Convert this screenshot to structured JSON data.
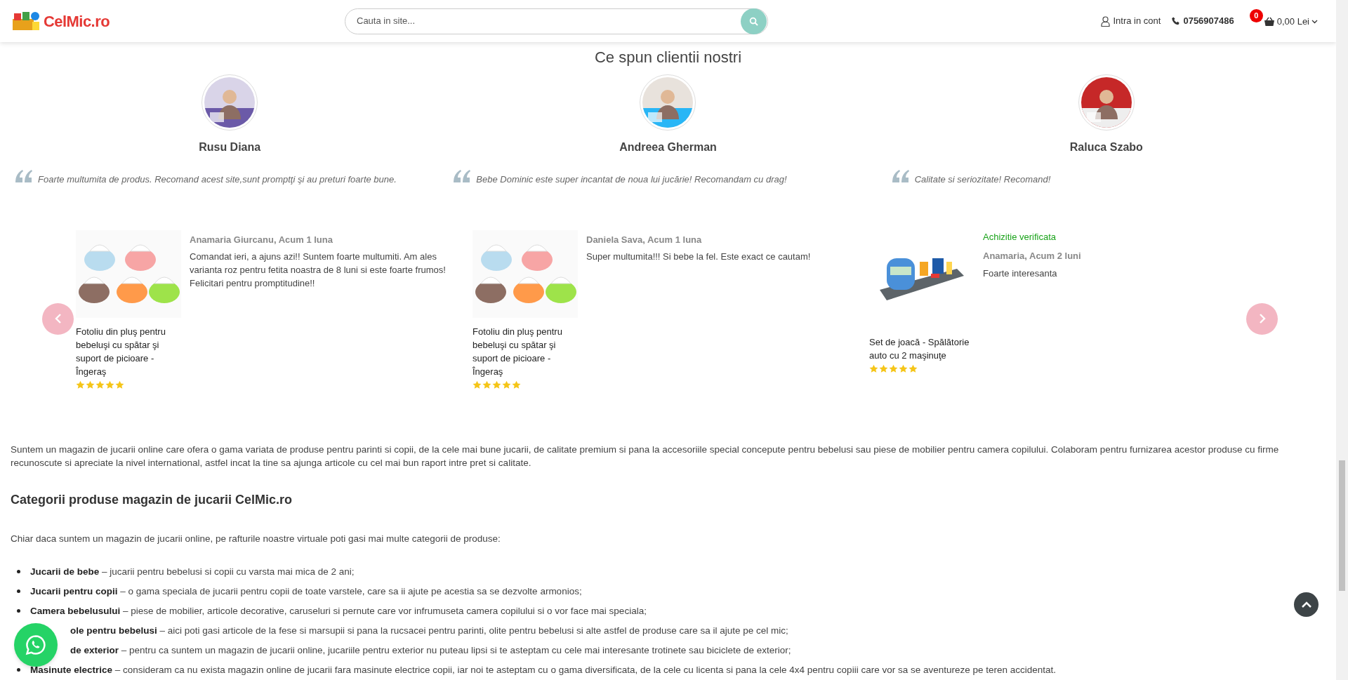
{
  "header": {
    "logo": "CelMic.ro",
    "search": {
      "placeholder": "Cauta in site..."
    },
    "account": "Intra in cont",
    "phone": "0756907486",
    "cart": {
      "count": "0",
      "total": "0,00 Lei"
    }
  },
  "testimonials": {
    "title": "Ce spun clientii nostri",
    "items": [
      {
        "name": "Rusu Diana",
        "quote": "Foarte multumita de produs. Recomand acest site,sunt promptţi şi au preturi foarte bune."
      },
      {
        "name": "Andreea Gherman",
        "quote": "Bebe Dominic este super incantat de noua lui jucărie! Recomandam cu drag!"
      },
      {
        "name": "Raluca Szabo",
        "quote": "Calitate si seriozitate! Recomand!"
      }
    ]
  },
  "reviews": [
    {
      "verified": false,
      "author": "Anamaria Giurcanu, Acum 1 luna",
      "text": "Comandat ieri, a ajuns azi!! Suntem foarte multumiti. Am ales varianta roz pentru fetita noastra de 8 luni si este foarte frumos! Felicitari pentru promptitudine!!",
      "product": "Fotoliu din pluş pentru bebeluşi cu spătar şi suport de picioare - Îngeraş",
      "stars": 5,
      "kind": "seats"
    },
    {
      "verified": false,
      "author": "Daniela Sava, Acum 1 luna",
      "text": "Super multumita!!! Si bebe la fel. Este exact ce cautam!",
      "product": "Fotoliu din pluş pentru bebeluşi cu spătar şi suport de picioare - Îngeraş",
      "stars": 5,
      "kind": "seats"
    },
    {
      "verified": true,
      "verified_label": "Achizitie verificata",
      "author": "Anamaria, Acum 2 luni",
      "text": "Foarte interesanta",
      "product": "Set de joacă - Spălătorie auto cu 2 maşinuţe",
      "stars": 5,
      "kind": "carwash"
    }
  ],
  "about": {
    "intro": "Suntem un magazin de jucarii online care ofera o gama variata de produse pentru parinti si copii, de la cele mai bune jucarii, de calitate premium si pana la accesoriile special concepute pentru bebelusi sau piese de mobilier pentru camera copilului. Colaboram pentru furnizarea acestor produse cu firme recunoscute si apreciate la nivel international, astfel incat la tine sa ajunga articole cu cel mai bun raport intre pret si calitate.",
    "heading": "Categorii produse magazin de jucarii CelMic.ro",
    "lead": "Chiar daca suntem un magazin de jucarii online, pe rafturile noastre virtuale poti gasi mai multe categorii de produse:",
    "categories": [
      {
        "kind": "full",
        "term": "Jucarii de bebe",
        "desc": " – jucarii pentru bebelusi si copii cu varsta mai mica de 2 ani;"
      },
      {
        "kind": "full",
        "term": "Jucarii pentru copii",
        "desc": " – o gama speciala de jucarii pentru copii de toate varstele, care sa ii ajute pe acestia sa se dezvolte armonios;"
      },
      {
        "kind": "full",
        "term": "Camera bebelusului",
        "desc": " – piese de mobilier, articole decorative, caruseluri si pernute care vor infrumuseta camera copilului si o vor face mai speciala;"
      },
      {
        "kind": "covered",
        "term": "ole pentru bebelusi",
        "desc": " – aici poti gasi articole de la fese si marsupii si pana la rucsacei pentru parinti, olite pentru bebelusi si alte astfel de produse care sa il ajute pe cel mic;"
      },
      {
        "kind": "covered",
        "term": "de exterior",
        "desc": " – pentru ca suntem un magazin de jucarii online, jucariile pentru exterior nu puteau lipsi si te asteptam cu cele mai interesante trotinete sau biciclete de exterior;"
      },
      {
        "kind": "full",
        "term": "Masinute electrice",
        "desc": " – consideram ca nu exista magazin online de jucarii fara masinute electrice copii, iar noi te asteptam cu o gama diversificata, de la cele cu licenta si pana la cele 4x4 pentru copiii care vor sa se aventureze pe teren accidentat."
      }
    ]
  }
}
